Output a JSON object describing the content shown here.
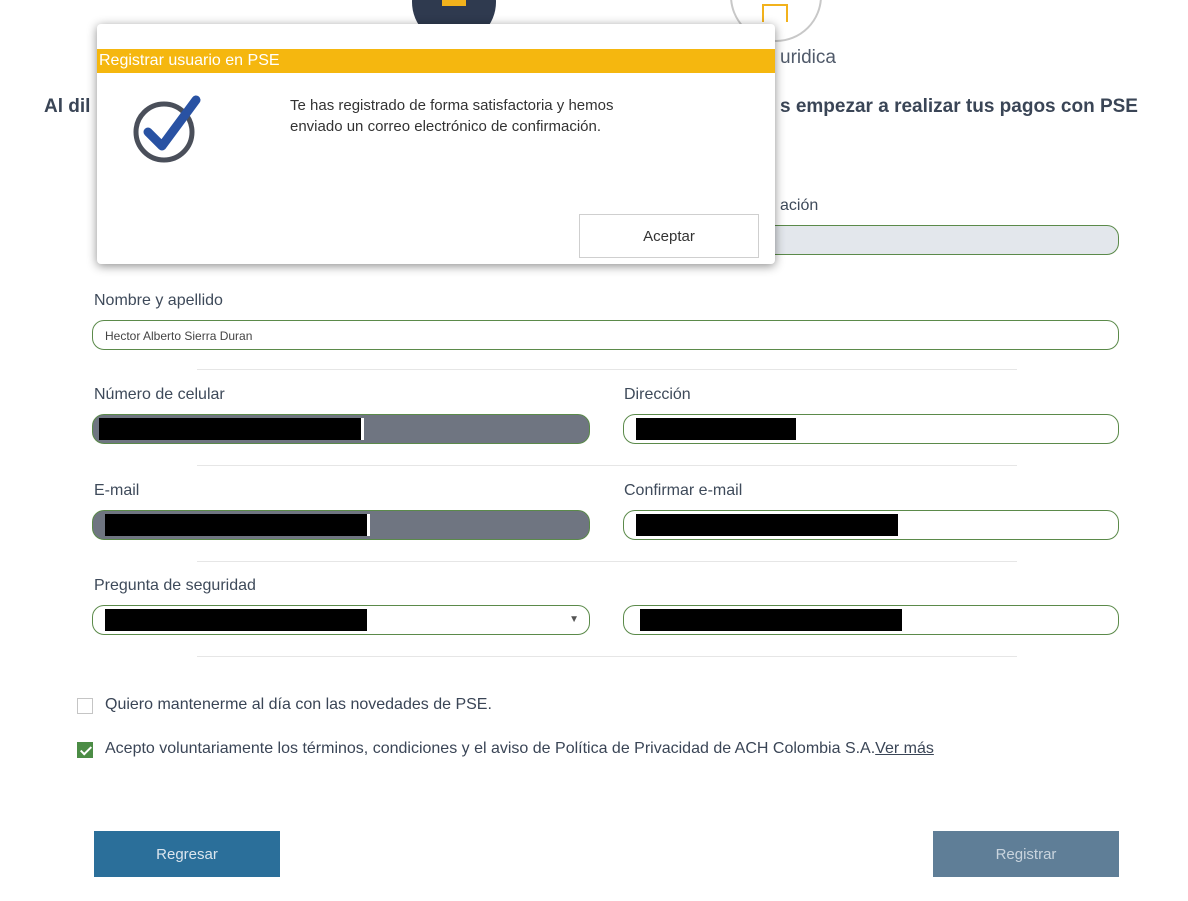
{
  "header": {
    "step_juridica": "uridica",
    "headline_left": "Al dil",
    "headline_right": "s empezar a realizar tus pagos con PSE"
  },
  "form": {
    "identificacion_label_partial": "ación",
    "nombre_label": "Nombre y apellido",
    "nombre_value": "Hector Alberto Sierra Duran",
    "celular_label": "Número de celular",
    "direccion_label": "Dirección",
    "email_label": "E-mail",
    "confirm_email_label": "Confirmar e-mail",
    "pregunta_label": "Pregunta de seguridad"
  },
  "checks": {
    "novedades": "Quiero mantenerme al día con las novedades de PSE.",
    "terminos": "Acepto voluntariamente los términos, condiciones y el aviso de Política de Privacidad de ACH Colombia S.A.",
    "terminos_link": "Ver más",
    "novedades_checked": false,
    "terminos_checked": true
  },
  "buttons": {
    "back": "Regresar",
    "register": "Registrar"
  },
  "modal": {
    "title": "Registrar usuario en PSE",
    "message_line1": "Te has registrado de forma satisfactoria y hemos",
    "message_line2": "enviado un correo electrónico de confirmación.",
    "accept": "Aceptar",
    "icon": "check-circle-icon"
  },
  "colors": {
    "modal_header": "#f5b70f",
    "field_border": "#5b8a4a",
    "back_button": "#2b6f9a",
    "register_button": "#5f7e97",
    "checkbox_checked": "#4b8c45"
  }
}
